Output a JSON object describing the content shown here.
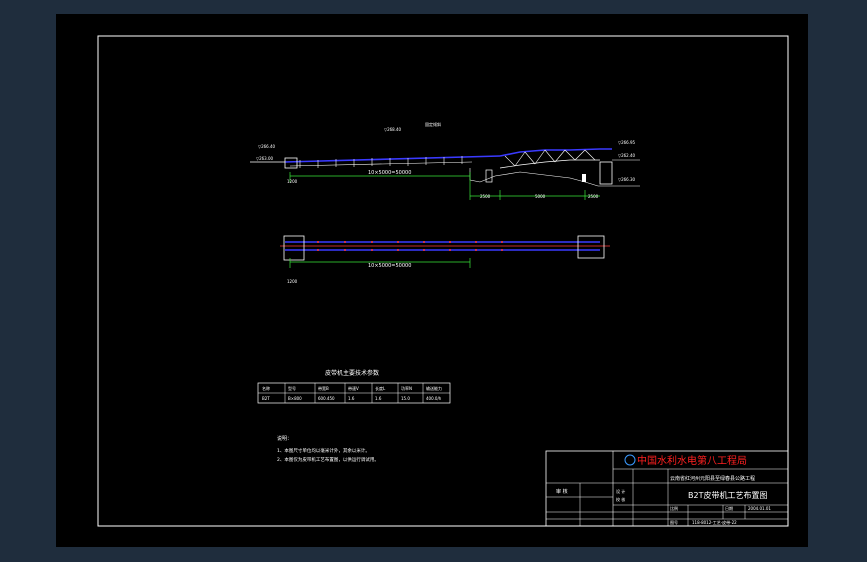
{
  "drawing": {
    "elevation_labels": [
      "▽266.40",
      "▽263.00",
      "▽268.40",
      "▽266.95",
      "▽262.40",
      "▽266.30"
    ],
    "dim_length": "10×5000=50000",
    "dim_length_plan": "10×5000=50000",
    "dim_small": [
      "1200",
      "2500",
      "5000",
      "2500"
    ],
    "drop_label": "固定倾斜"
  },
  "spec_table": {
    "title": "皮带机主要技术参数",
    "headers": [
      "名称",
      "型号",
      "带宽B",
      "带速V",
      "长度L",
      "功率N",
      "输送能力"
    ],
    "rows": [
      [
        "B2T",
        "B×800",
        "600.450",
        "1.6",
        "1.6",
        "15.0",
        "400.0/h"
      ]
    ]
  },
  "notes": {
    "heading": "说明：",
    "lines": [
      "1、本图尺寸单位均以毫米计外，其余以米计。",
      "2、本图仅为皮带机工艺布置图，以供运行调试用。"
    ]
  },
  "title_block": {
    "company": "中国水利水电第八工程局",
    "project": "云南省红河州元阳县至绿春县公路工程",
    "drawing_title": "B2T皮带机工艺布置图",
    "approve_label": "审 核",
    "design_label": "设 计",
    "check_label": "校 核",
    "scale_label": "比例",
    "date_label": "日期",
    "drawing_no": "118-8012-工艺-皮带-22",
    "date_value": "2004.01.01",
    "sheet_label": "图号"
  },
  "colors": {
    "frame": "#ffffff",
    "belt": "#3a3aff",
    "axis": "#ff3a3a",
    "dim": "#39e639",
    "bg": "#000000",
    "company": "#ff2020"
  }
}
